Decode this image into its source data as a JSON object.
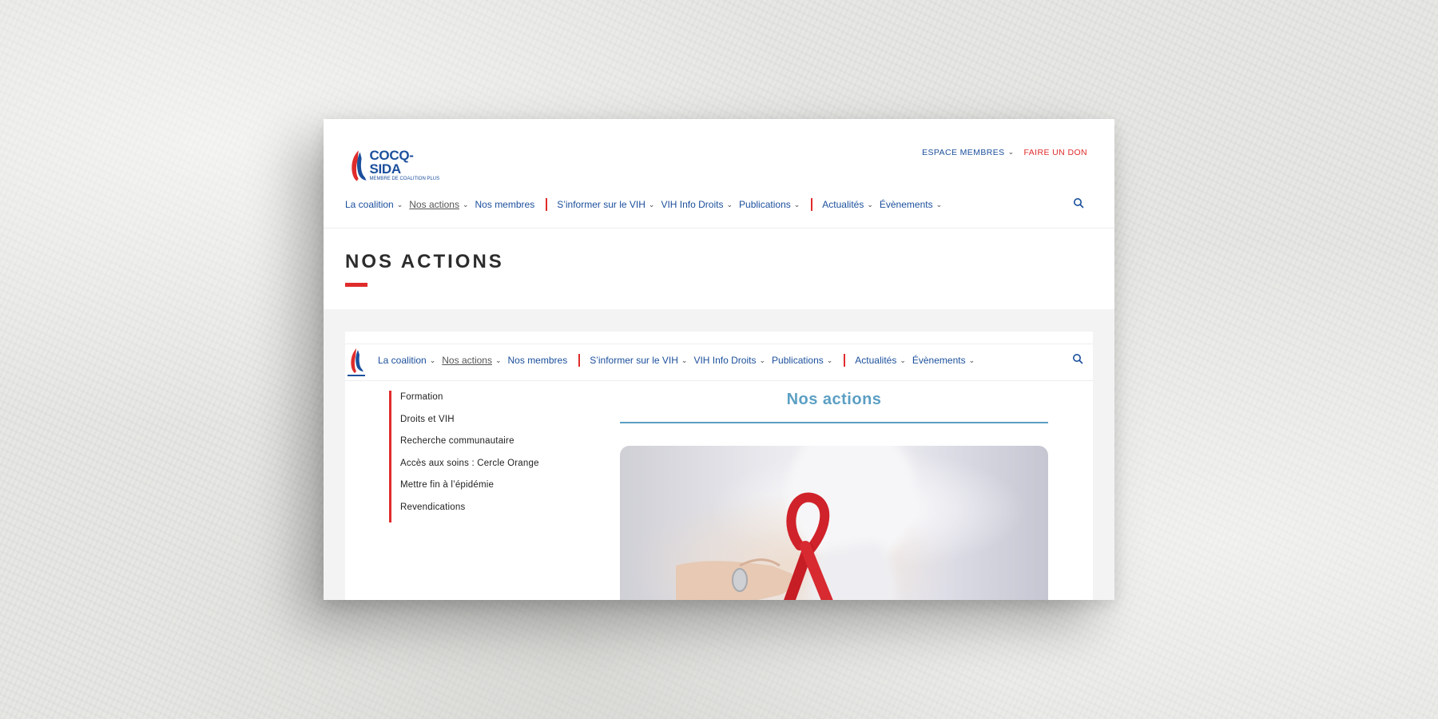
{
  "logo": {
    "name": "COCQ-SIDA",
    "tagline": "MEMBRE DE COALITION PLUS"
  },
  "toplinks": {
    "members": "ESPACE MEMBRES",
    "donate": "FAIRE UN DON"
  },
  "nav": {
    "items": [
      "La coalition",
      "Nos actions",
      "Nos membres",
      "S’informer sur le VIH",
      "VIH Info Droits",
      "Publications",
      "Actualités",
      "Évènements"
    ]
  },
  "page": {
    "title": "NOS ACTIONS"
  },
  "inner": {
    "submenu": [
      "Formation",
      "Droits et VIH",
      "Recherche communautaire",
      "Accès aux soins : Cercle Orange",
      "Mettre fin à l’épidémie",
      "Revendications"
    ],
    "title": "Nos actions"
  },
  "colors": {
    "brand_blue": "#1b4f9c",
    "accent_red": "#e02b2b",
    "heading_blue": "#5b9fc3"
  }
}
